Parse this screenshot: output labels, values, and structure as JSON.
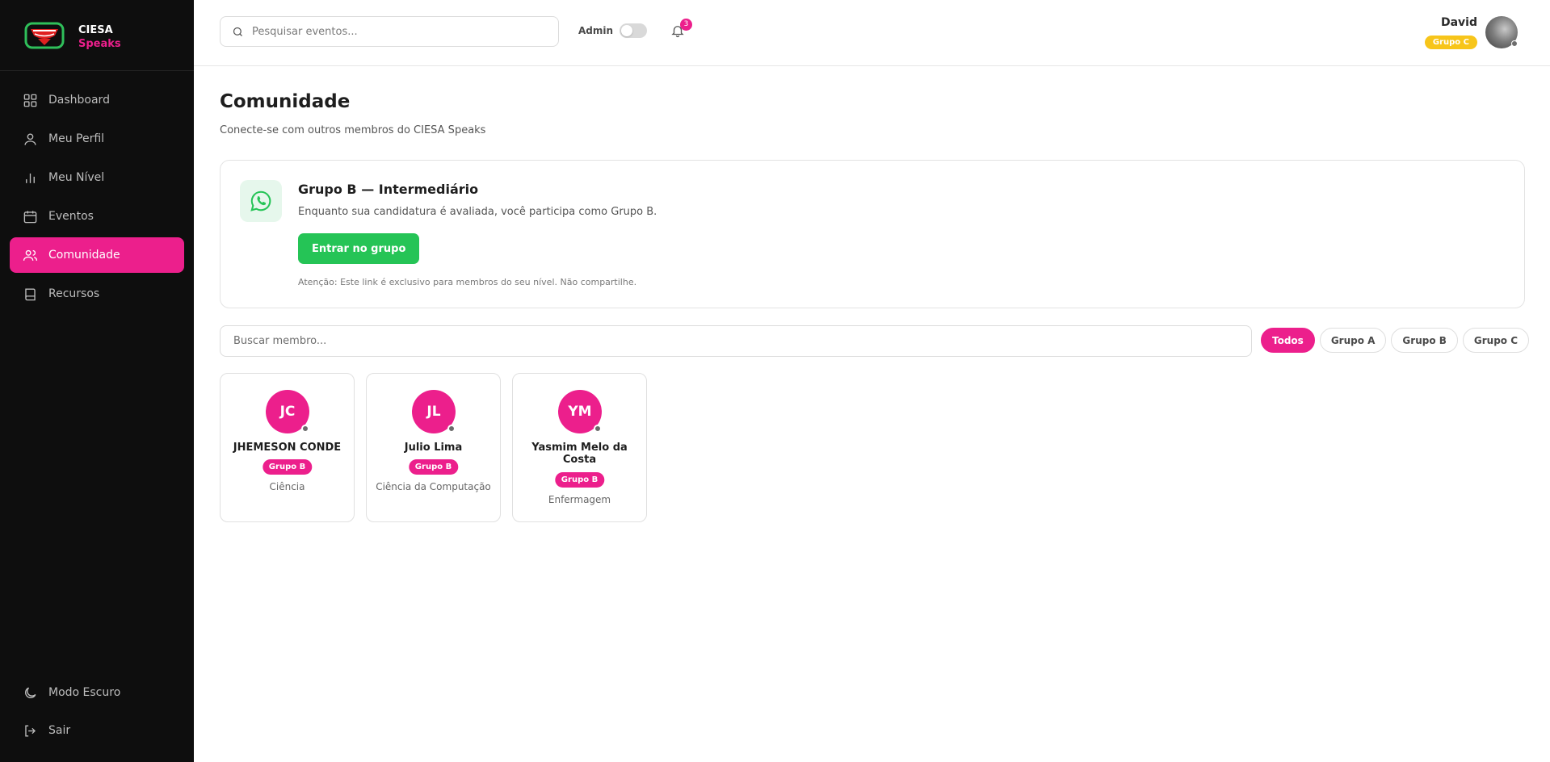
{
  "brand": {
    "line1": "CIESA",
    "line2": "Speaks"
  },
  "sidebar": {
    "items": [
      {
        "label": "Dashboard",
        "icon": "grid-icon"
      },
      {
        "label": "Meu Perfil",
        "icon": "user-icon"
      },
      {
        "label": "Meu Nível",
        "icon": "bar-chart-icon"
      },
      {
        "label": "Eventos",
        "icon": "calendar-icon"
      },
      {
        "label": "Comunidade",
        "icon": "users-icon",
        "active": true
      },
      {
        "label": "Recursos",
        "icon": "book-icon"
      }
    ],
    "bottom": [
      {
        "label": "Modo Escuro",
        "icon": "moon-icon"
      },
      {
        "label": "Sair",
        "icon": "logout-icon"
      }
    ]
  },
  "topbar": {
    "search_placeholder": "Pesquisar eventos...",
    "admin_label": "Admin",
    "admin_toggle_on": false,
    "notification_count": "3",
    "user_name": "David",
    "user_group": "Grupo C"
  },
  "main": {
    "title": "Comunidade",
    "subtitle": "Conecte-se com outros membros do CIESA Speaks",
    "whatsapp": {
      "title": "Grupo B — Intermediário",
      "description": "Enquanto sua candidatura é avaliada, você participa como Grupo B.",
      "button": "Entrar no grupo",
      "note": "Atenção: Este link é exclusivo para membros do seu nível. Não compartilhe."
    },
    "member_search_placeholder": "Buscar membro...",
    "filters": [
      {
        "label": "Todos",
        "active": true
      },
      {
        "label": "Grupo A",
        "active": false
      },
      {
        "label": "Grupo B",
        "active": false
      },
      {
        "label": "Grupo C",
        "active": false
      }
    ],
    "members": [
      {
        "initials": "JC",
        "name": "JHEMESON CONDE",
        "group": "Grupo B",
        "course": "Ciência"
      },
      {
        "initials": "JL",
        "name": "Julio Lima",
        "group": "Grupo B",
        "course": "Ciência da Computação"
      },
      {
        "initials": "YM",
        "name": "Yasmim Melo da Costa",
        "group": "Grupo B",
        "course": "Enfermagem"
      }
    ]
  },
  "colors": {
    "accent": "#ec1f8c",
    "sidebar_bg": "#0e0e0e",
    "whatsapp_green": "#25c456",
    "group_c_badge": "#f7c51a"
  }
}
